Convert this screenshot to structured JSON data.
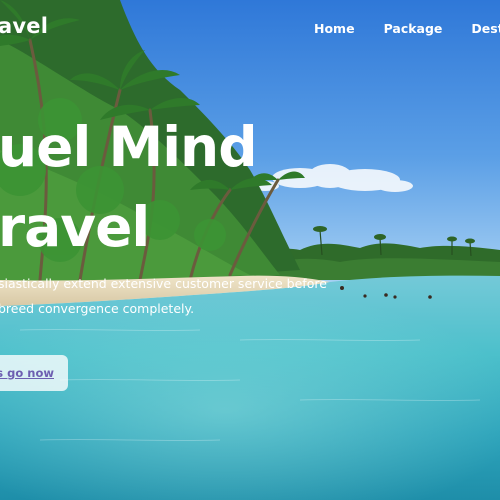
{
  "header": {
    "brand": "avel",
    "nav": [
      "Home",
      "Package",
      "Destin"
    ]
  },
  "hero": {
    "title_line1": "uel Mind",
    "title_line2": "ravel",
    "subtitle_line1": "siastically extend extensive customer service before",
    "subtitle_line2": "breed convergence completely.",
    "cta": "t's go now"
  }
}
